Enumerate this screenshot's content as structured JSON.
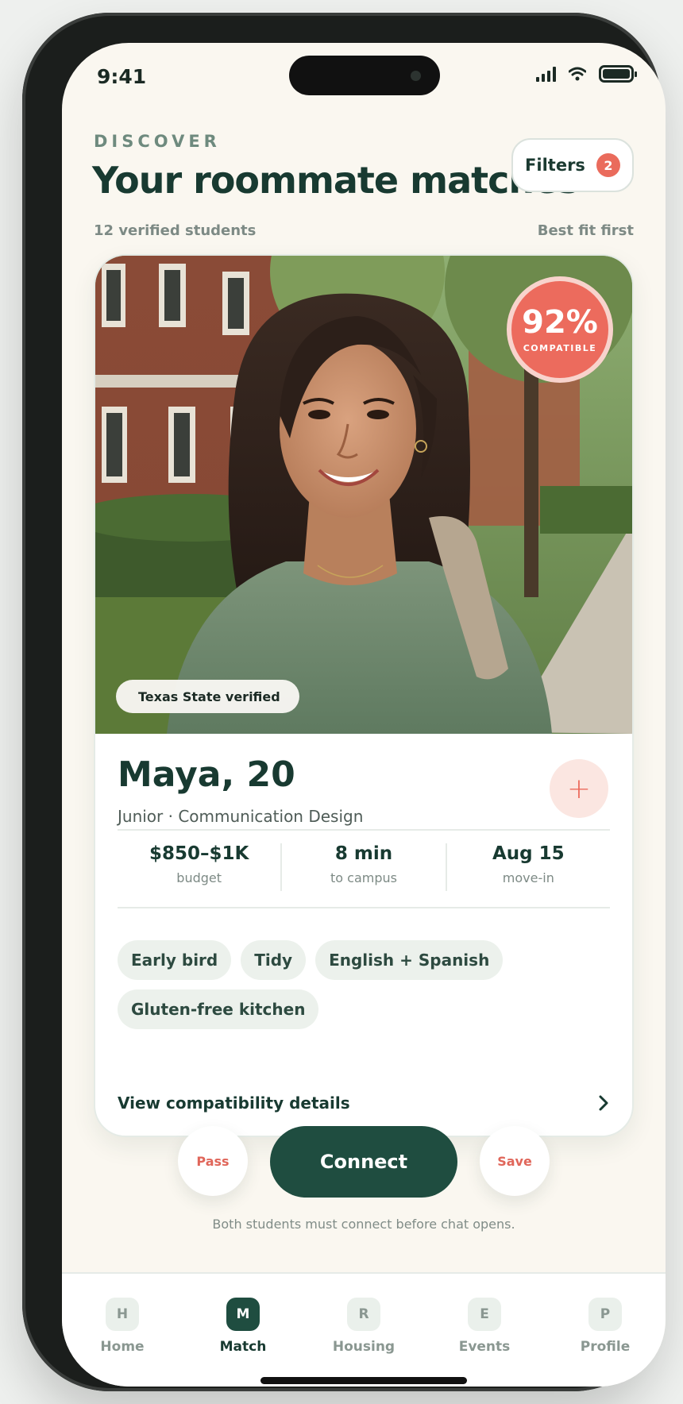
{
  "status_bar": {
    "time": "9:41"
  },
  "header": {
    "eyebrow": "DISCOVER",
    "title": "Your roommate matches",
    "filters_label": "Filters",
    "filters_count": "2",
    "count_text": "12 verified students",
    "sort_text": "Best fit first"
  },
  "profile": {
    "compat_percent": "92%",
    "compat_label": "COMPATIBLE",
    "verified_badge": "Texas State verified",
    "name_age": "Maya, 20",
    "major": "Junior · Communication Design",
    "add_symbol": "+",
    "stats": [
      {
        "value": "$850–$1K",
        "label": "budget"
      },
      {
        "value": "8 min",
        "label": "to campus"
      },
      {
        "value": "Aug 15",
        "label": "move-in"
      }
    ],
    "tags": [
      "Early bird",
      "Tidy",
      "English + Spanish",
      "Gluten-free kitchen"
    ],
    "details_link": "View compatibility details"
  },
  "actions": {
    "pass_label": "Pass",
    "connect_label": "Connect",
    "save_label": "Save",
    "hint": "Both students must connect before chat opens."
  },
  "tabs": [
    {
      "icon": "H",
      "label": "Home"
    },
    {
      "icon": "M",
      "label": "Match"
    },
    {
      "icon": "R",
      "label": "Housing"
    },
    {
      "icon": "E",
      "label": "Events"
    },
    {
      "icon": "P",
      "label": "Profile"
    }
  ],
  "colors": {
    "brand_green": "#1f4d40",
    "accent_coral": "#ec6b5d",
    "background": "#faf7f0"
  }
}
